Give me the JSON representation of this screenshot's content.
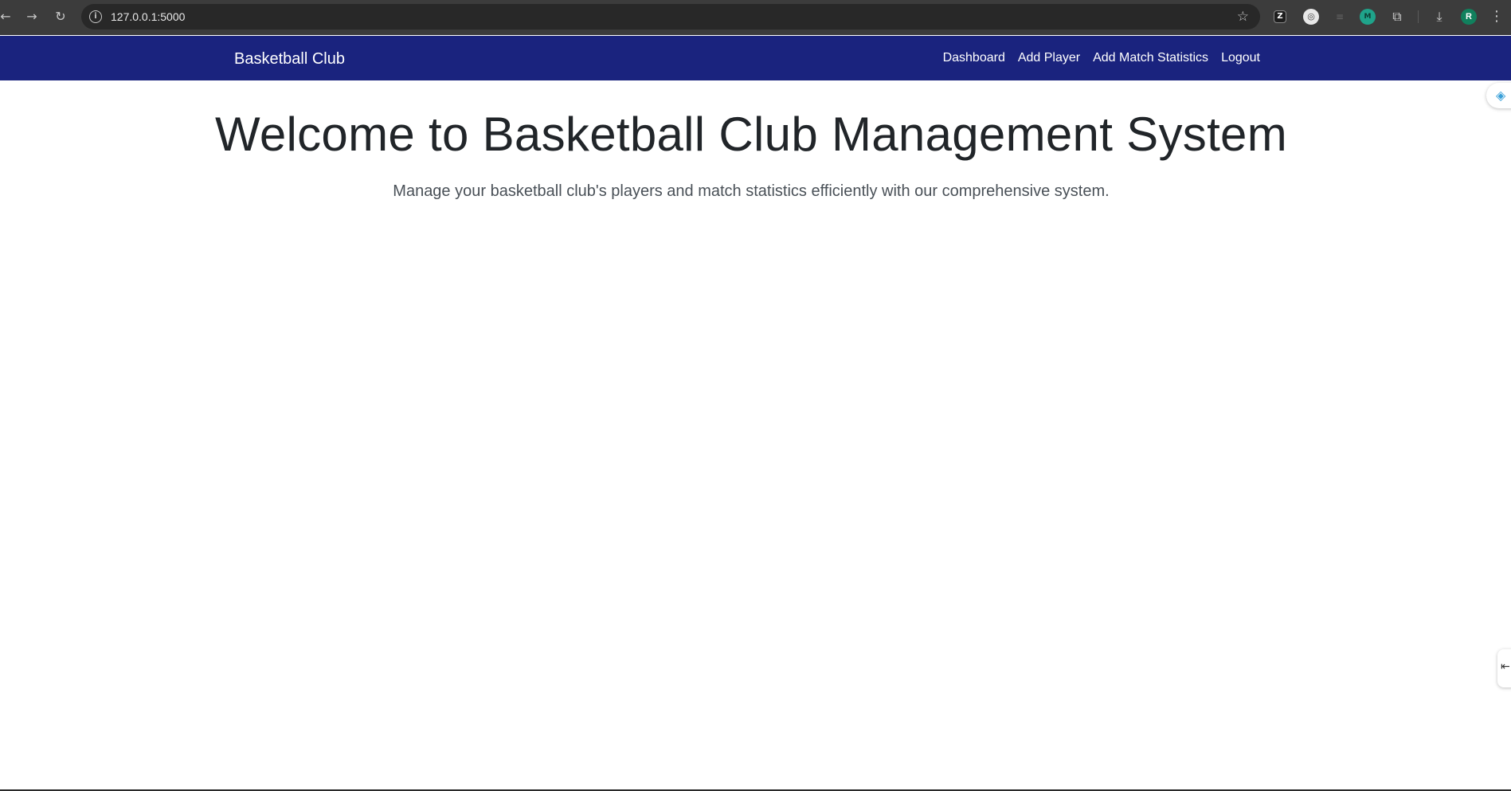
{
  "browser": {
    "url": "127.0.0.1:5000",
    "profile_initial": "R"
  },
  "navbar": {
    "brand": "Basketball Club",
    "links": [
      "Dashboard",
      "Add Player",
      "Add Match Statistics",
      "Logout"
    ],
    "background": "#1a237e"
  },
  "hero": {
    "title": "Welcome to Basketball Club Management System",
    "subtitle": "Manage your basketball club's players and match statistics efficiently with our comprehensive system."
  }
}
